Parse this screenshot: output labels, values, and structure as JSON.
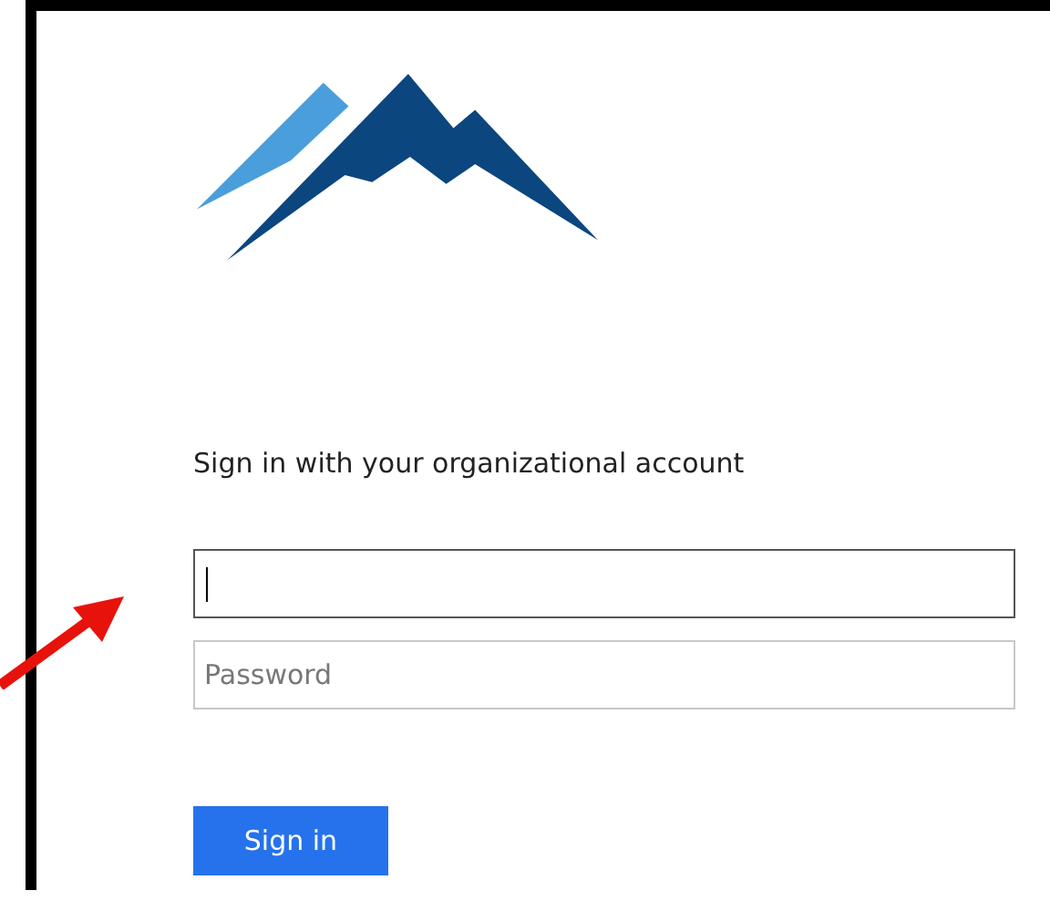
{
  "heading": "Sign in with your organizational account",
  "username": {
    "focused": true
  },
  "password": {
    "placeholder": "Password",
    "focused": false
  },
  "button": {
    "label": "Sign in"
  }
}
